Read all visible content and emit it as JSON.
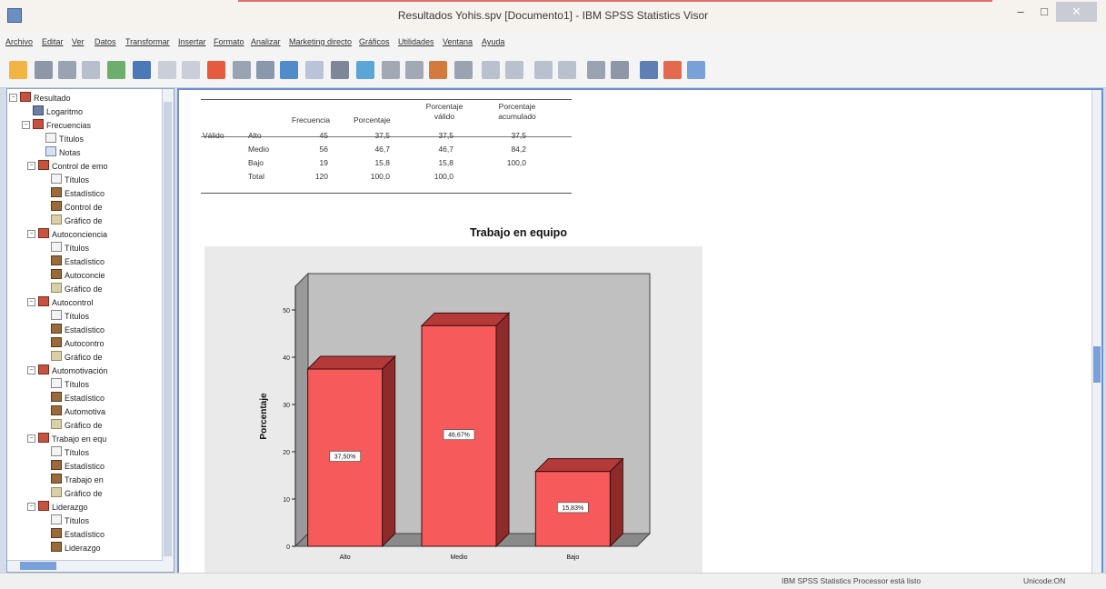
{
  "window": {
    "title": "Resultados Yohis.spv [Documento1] - IBM SPSS Statistics Visor",
    "minimize": "–",
    "maximize": "□"
  },
  "menu": [
    "Archivo",
    "Editar",
    "Ver",
    "Datos",
    "Transformar",
    "Insertar",
    "Formato",
    "Analizar",
    "Marketing directo",
    "Gráficos",
    "Utilidades",
    "Ventana",
    "Ayuda"
  ],
  "tree": [
    {
      "label": "Resultado",
      "icon": "book-icon"
    },
    {
      "label": "Logaritmo",
      "icon": "log-icon"
    },
    {
      "label": "Frecuencias",
      "icon": "book-icon"
    },
    {
      "label": "Títulos",
      "icon": "title-icon"
    },
    {
      "label": "Notas",
      "icon": "notes-icon"
    },
    {
      "label": "Control de emo",
      "icon": "book-icon"
    },
    {
      "label": "Títulos",
      "icon": "title-icon"
    },
    {
      "label": "Estadístico",
      "icon": "table-icon"
    },
    {
      "label": "Control de",
      "icon": "table-icon"
    },
    {
      "label": "Gráfico de",
      "icon": "chart-icon"
    },
    {
      "label": "Autoconciencia",
      "icon": "book-icon"
    },
    {
      "label": "Títulos",
      "icon": "title-icon"
    },
    {
      "label": "Estadístico",
      "icon": "table-icon"
    },
    {
      "label": "Autoconcie",
      "icon": "table-icon"
    },
    {
      "label": "Gráfico de",
      "icon": "chart-icon"
    },
    {
      "label": "Autocontrol",
      "icon": "book-icon"
    },
    {
      "label": "Títulos",
      "icon": "title-icon"
    },
    {
      "label": "Estadístico",
      "icon": "table-icon"
    },
    {
      "label": "Autocontro",
      "icon": "table-icon"
    },
    {
      "label": "Gráfico de",
      "icon": "chart-icon"
    },
    {
      "label": "Automotivación",
      "icon": "book-icon"
    },
    {
      "label": "Títulos",
      "icon": "title-icon"
    },
    {
      "label": "Estadístico",
      "icon": "table-icon"
    },
    {
      "label": "Automotiva",
      "icon": "table-icon"
    },
    {
      "label": "Gráfico de",
      "icon": "chart-icon"
    },
    {
      "label": "Trabajo en equ",
      "icon": "book-icon"
    },
    {
      "label": "Títulos",
      "icon": "title-icon"
    },
    {
      "label": "Estadístico",
      "icon": "table-icon"
    },
    {
      "label": "Trabajo en",
      "icon": "table-icon"
    },
    {
      "label": "Gráfico de",
      "icon": "chart-icon"
    },
    {
      "label": "Liderazgo",
      "icon": "book-icon"
    },
    {
      "label": "Títulos",
      "icon": "title-icon"
    },
    {
      "label": "Estadístico",
      "icon": "table-icon"
    },
    {
      "label": "Liderazgo",
      "icon": "table-icon"
    }
  ],
  "freq_table": {
    "headers": [
      "Frecuencia",
      "Porcentaje",
      "Porcentaje válido",
      "Porcentaje acumulado"
    ],
    "group_label": "Válido",
    "rows": [
      {
        "label": "Alto",
        "values": [
          "45",
          "37,5",
          "37,5",
          "37,5"
        ]
      },
      {
        "label": "Medio",
        "values": [
          "56",
          "46,7",
          "46,7",
          "84,2"
        ]
      },
      {
        "label": "Bajo",
        "values": [
          "19",
          "15,8",
          "15,8",
          "100,0"
        ]
      },
      {
        "label": "Total",
        "values": [
          "120",
          "100,0",
          "100,0",
          ""
        ]
      }
    ]
  },
  "chart_data": {
    "type": "bar",
    "title": "Trabajo en equipo",
    "ylabel": "Porcentaje",
    "xlabel": "",
    "categories": [
      "Alto",
      "Medio",
      "Bajo"
    ],
    "values": [
      37.5,
      46.67,
      15.83
    ],
    "data_labels": [
      "37,50%",
      "46,67%",
      "15,83%"
    ],
    "ylim": [
      0,
      55
    ],
    "yticks": [
      "0",
      "10",
      "20",
      "30",
      "40",
      "50"
    ],
    "bar_color": "#f65a5a",
    "grid": false,
    "legend": "none"
  },
  "status": {
    "processor": "IBM SPSS Statistics Processor está listo",
    "unicode": "Unicode:ON"
  }
}
